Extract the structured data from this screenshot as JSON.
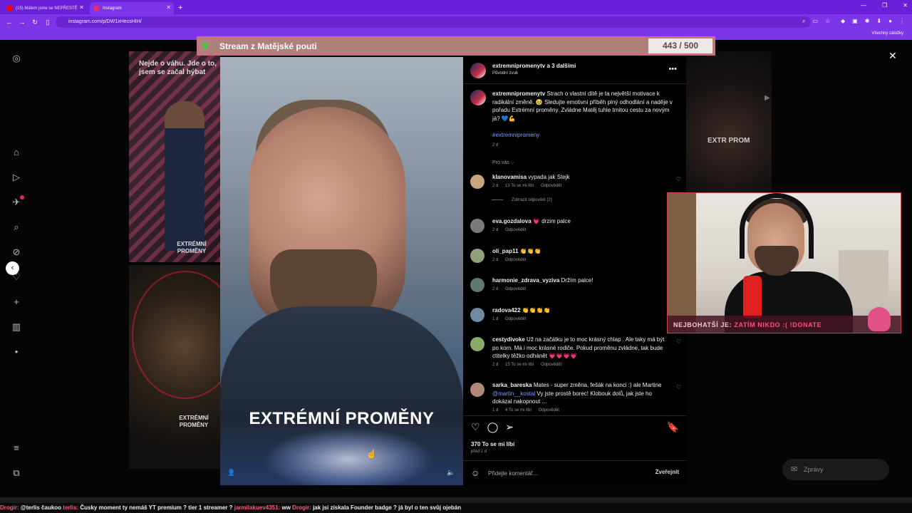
{
  "browser": {
    "tabs": [
      {
        "title": "(15) Málem jsme se NEPŘESTĚ",
        "favicon_color": "#ff0000"
      },
      {
        "title": "Instagram",
        "favicon_color": "#e1306c"
      }
    ],
    "new_tab": "+",
    "url": "instagram.com/p/DW1xHecsHIH/",
    "bookmarks_label": "Všechny záložky"
  },
  "overlay": {
    "stream_title": "Stream z Matějské pouti",
    "goal": "443 / 500",
    "top_donor_label": "NEJBOHATŠÍ JE:",
    "top_donor_value": "ZATÍM NIKDO :( !DONATE"
  },
  "background": {
    "thumb1_text": "Nejde o váhu. Jde o to, jsem se začal hýbat",
    "thumb1_label": "EXTRÉMNÍ PROMĚNY",
    "thumb2_label": "EXTRÉMNÍ PROMĚNY",
    "right_thumb_text": "EXTR PROM"
  },
  "video": {
    "title": "EXTRÉMNÍ PROMĚNY"
  },
  "post": {
    "author": "extremnipromenytv",
    "coauthors": "a 3 dalšími",
    "audio": "Původní zvuk",
    "caption_user": "extremnipromenytv",
    "caption": "Strach o vlastní dítě je ta největší motivace k radikální změně. 🥹 Sledujte emotivní příběh plný odhodlání a naděje v pořadu Extrémní proměny. Zvládne Matěj tuhle trnitou cestu za novým já? 💙💪",
    "hashtag": "#extremnipromeny",
    "caption_time": "2 d",
    "sort_label": "Pro vás ⌵",
    "likes": "370 To se mi líbí",
    "post_time": "před 2 d",
    "comment_placeholder": "Přidejte komentář...",
    "post_button": "Zveřejnit"
  },
  "comments": [
    {
      "user": "klanovamisa",
      "text": "vypada jak Stejk",
      "time": "2 d",
      "likes": "13 To se mi líbí",
      "reply": "Odpovědět",
      "avatar_color": "#c9a37a"
    },
    {
      "user": "eva.gozdalova",
      "text": "💗 drzim palce",
      "time": "2 d",
      "likes": "",
      "reply": "Odpovědět",
      "avatar_color": "#7a7a7a"
    },
    {
      "user": "oli_pap11",
      "text": "👏👏👏",
      "time": "2 d",
      "likes": "",
      "reply": "Odpovědět",
      "avatar_color": "#8fa07a"
    },
    {
      "user": "harmonie_zdrava_vyziva",
      "text": "Držím palce!",
      "time": "2 d",
      "likes": "",
      "reply": "Odpovědět",
      "avatar_color": "#5e7a6a"
    },
    {
      "user": "radova422",
      "text": "👏👏👏👏",
      "time": "1 d",
      "likes": "",
      "reply": "Odpovědět",
      "avatar_color": "#6f8aa0"
    },
    {
      "user": "cestydivoke",
      "text": "Už na začátku je to moc krásný chlap . Ale taky má být po kom. Má i moc krásné rodiče. Pokud proměnu zvládne, tak bude ctitelky těžko odhánět 💗💗💗💗",
      "time": "2 d",
      "likes": "15 To se mi líbí",
      "reply": "Odpovědět",
      "avatar_color": "#8aa86a"
    },
    {
      "user": "sarka_bareska",
      "text_before": "Mates - super změna, fešák na konci :) ale Martine ",
      "mention": "@martin__kostal",
      "text_after": " Vy jste prostě borec! Klobouk dolů, jak jste ho dokázal nakopnout ...",
      "time": "1 d",
      "likes": "4 To se mi líbí",
      "reply": "Odpovědět",
      "avatar_color": "#b08a76"
    }
  ],
  "replies_label": "Zobrazit odpovědi (2)",
  "messages_label": "Zprávy",
  "chat_ticker": [
    {
      "name": "Drogir:",
      "msg": "@terlis čaukoo"
    },
    {
      "name": "terlis:",
      "msg": "Čusky"
    },
    {
      "name": "",
      "msg": "moment ty nemáš YT premium ?"
    },
    {
      "name": "",
      "msg": "tier 1 streamer ?"
    },
    {
      "name": "jarmilakuev4351:",
      "msg": "ww"
    },
    {
      "name": "Drogir:",
      "msg": "jak jsi získala Founder badge ? já byl o ten svůj ojebán"
    }
  ],
  "colors": {
    "browser_purple": "#7c35e8",
    "banner": "#b0807a",
    "link_blue": "#7e9dff",
    "heart_green": "#36d43b",
    "ticker_name": "#ff5a7a"
  }
}
